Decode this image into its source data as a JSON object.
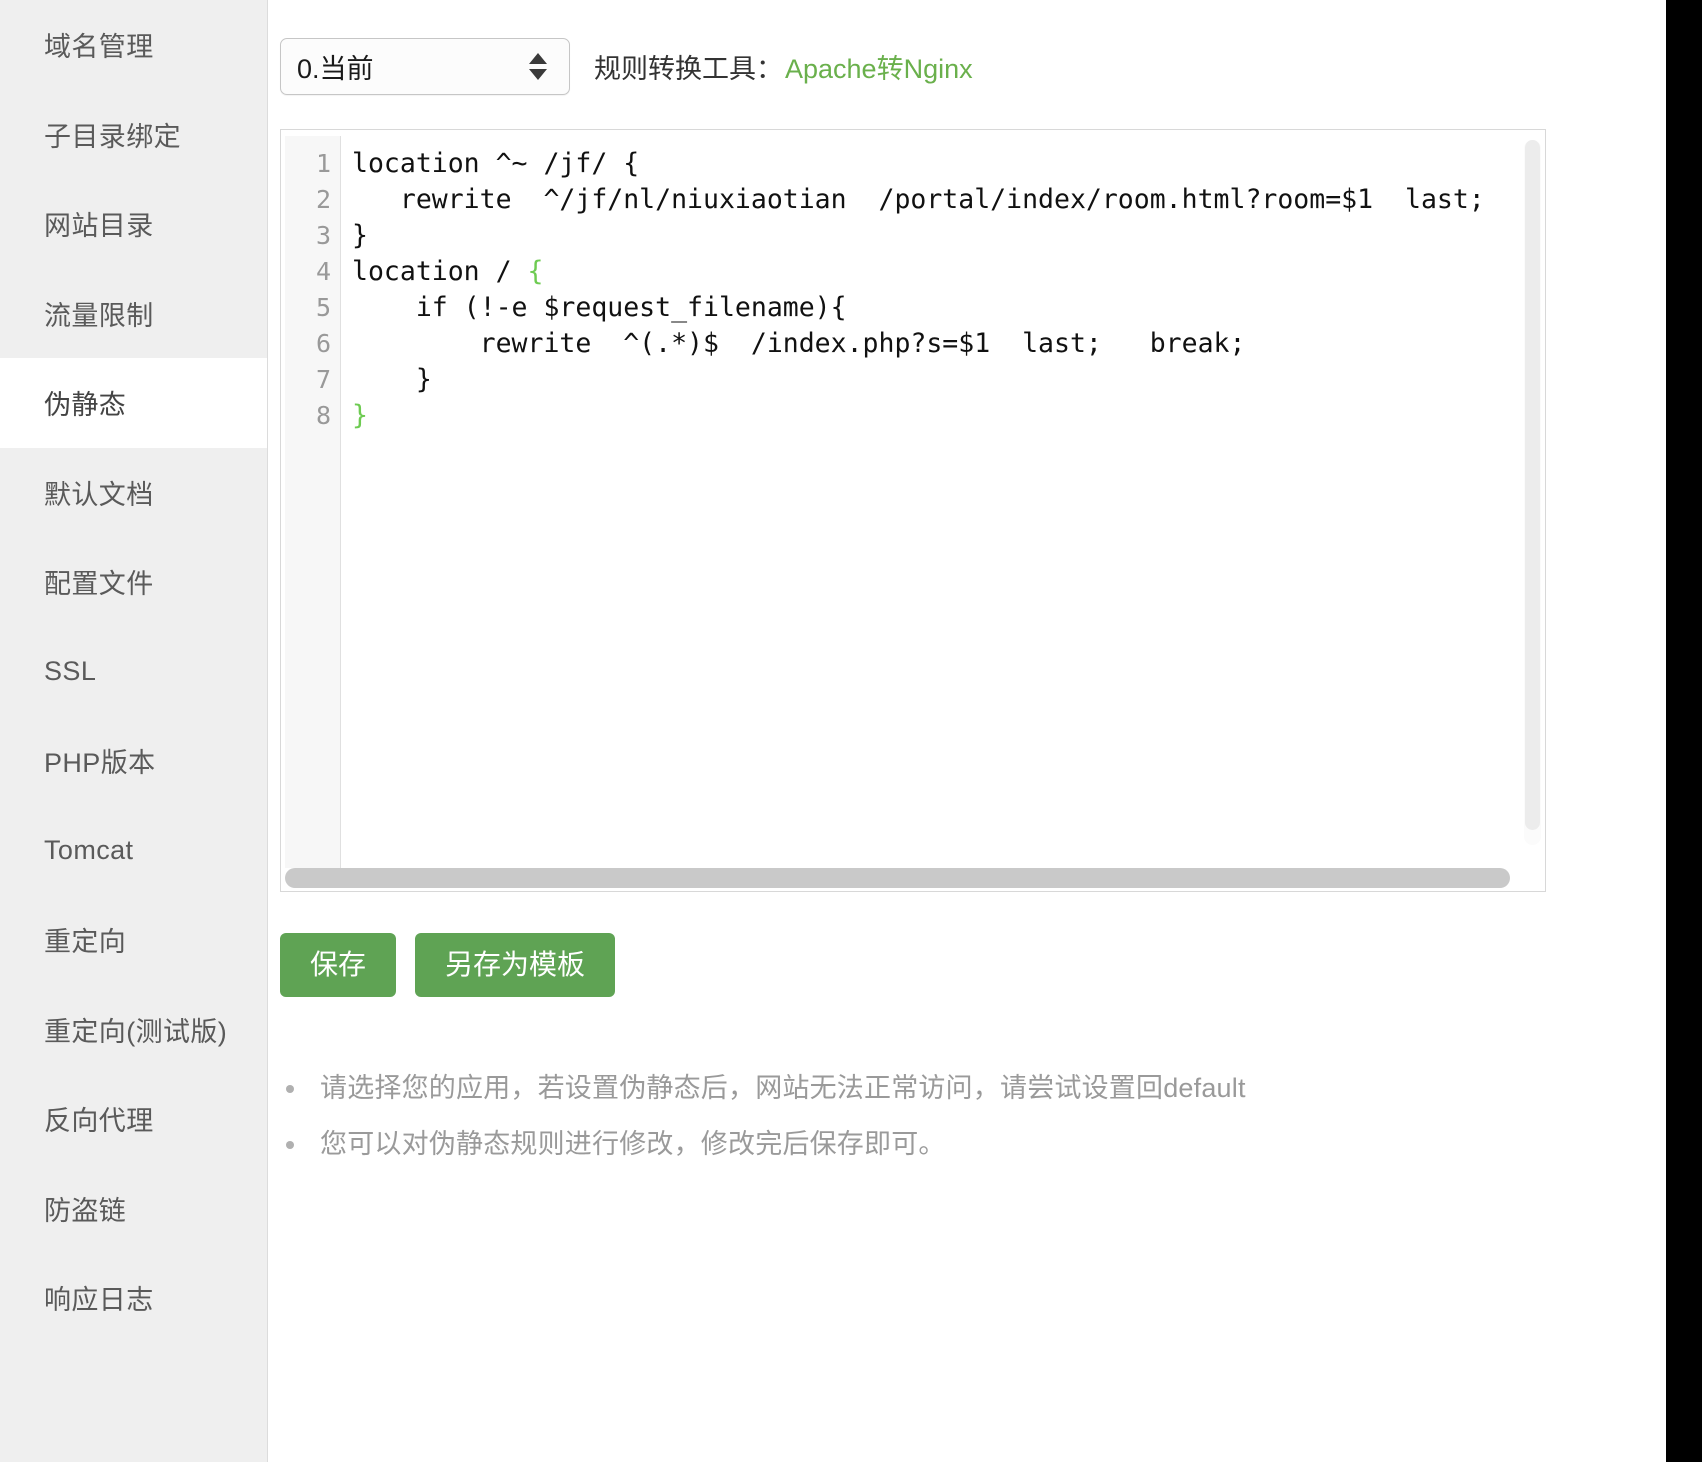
{
  "sidebar": {
    "items": [
      {
        "label": "域名管理",
        "active": false
      },
      {
        "label": "子目录绑定",
        "active": false
      },
      {
        "label": "网站目录",
        "active": false
      },
      {
        "label": "流量限制",
        "active": false
      },
      {
        "label": "伪静态",
        "active": true
      },
      {
        "label": "默认文档",
        "active": false
      },
      {
        "label": "配置文件",
        "active": false
      },
      {
        "label": "SSL",
        "active": false
      },
      {
        "label": "PHP版本",
        "active": false
      },
      {
        "label": "Tomcat",
        "active": false
      },
      {
        "label": "重定向",
        "active": false
      },
      {
        "label": "重定向(测试版)",
        "active": false
      },
      {
        "label": "反向代理",
        "active": false
      },
      {
        "label": "防盗链",
        "active": false
      },
      {
        "label": "响应日志",
        "active": false
      }
    ]
  },
  "toolbar": {
    "rule_select_value": "0.当前",
    "converter_label": "规则转换工具：",
    "converter_link": "Apache转Nginx",
    "stepper_up_icon": "triangle-up-icon",
    "stepper_down_icon": "triangle-down-icon"
  },
  "editor": {
    "line_numbers": [
      "1",
      "2",
      "3",
      "4",
      "5",
      "6",
      "7",
      "8"
    ],
    "lines": [
      "location ^~ /jf/ {",
      "   rewrite  ^/jf/nl/niuxiaotian  /portal/index/room.html?room=$1  last;",
      "}",
      "location / {",
      "    if (!-e $request_filename){",
      "        rewrite  ^(.*)$  /index.php?s=$1  last;   break;",
      "    }",
      "}"
    ],
    "code_line1": "location ^~ /jf/ {",
    "code_line2": "   rewrite  ^/jf/nl/niuxiaotian  /portal/index/room.html?room=$1  last;",
    "code_line3": "}",
    "code_line4_a": "location / ",
    "code_line4_b": "{",
    "code_line5": "    if (!-e $request_filename){",
    "code_line6": "        rewrite  ^(.*)$  /index.php?s=$1  last;   break;",
    "code_line7": "    }",
    "code_line8": "}",
    "bracket_highlight_color": "#6ecb52"
  },
  "buttons": {
    "save": "保存",
    "save_as_template": "另存为模板",
    "color": "#5fa354"
  },
  "notes": [
    "请选择您的应用，若设置伪静态后，网站无法正常访问，请尝试设置回default",
    "您可以对伪静态规则进行修改，修改完后保存即可。"
  ],
  "colors": {
    "sidebar_bg": "#efefef",
    "accent_green": "#6ab04c",
    "button_green": "#5fa354",
    "note_text": "#9a9a9a"
  }
}
